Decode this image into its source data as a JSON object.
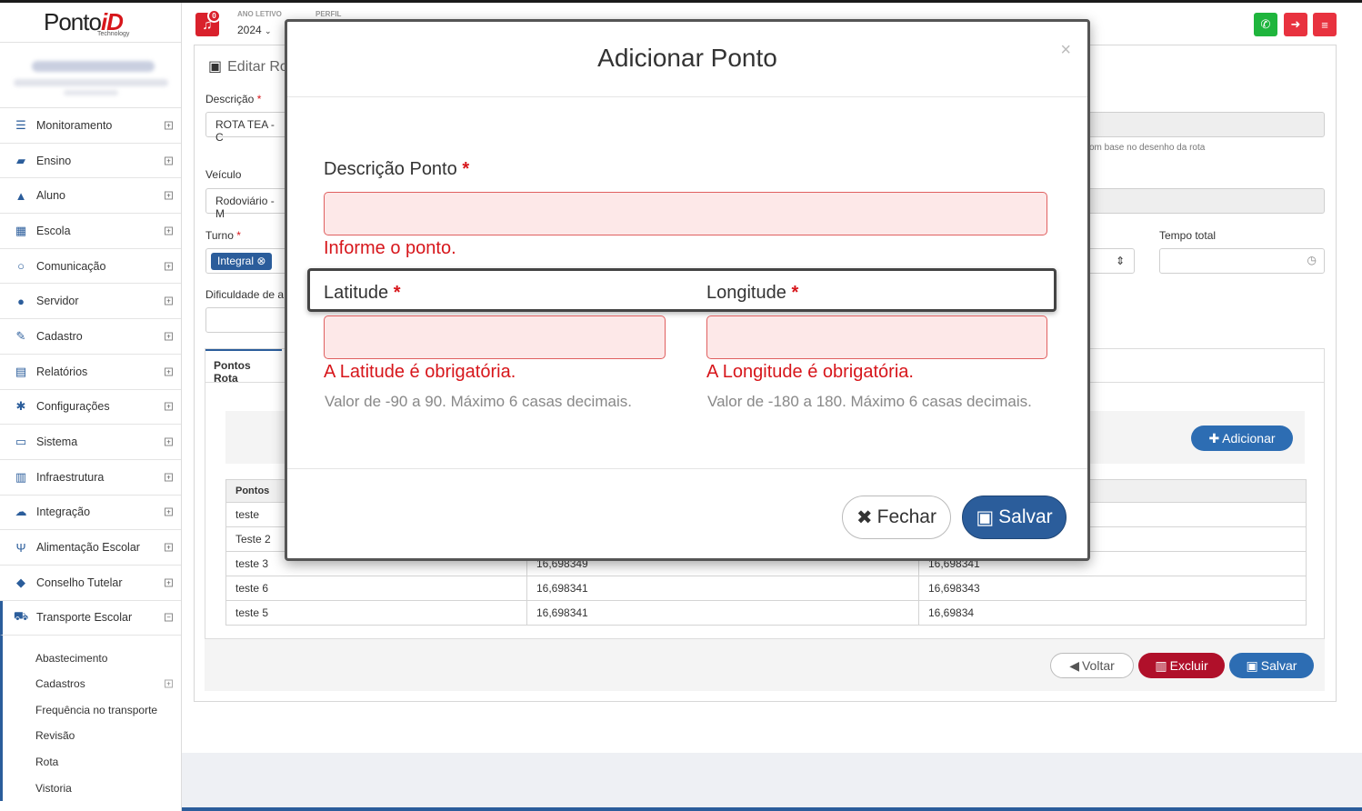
{
  "app": {
    "brand": "Ponto",
    "brand_id": "iD",
    "brand_sub": "Technology"
  },
  "header": {
    "notifications_count": "0",
    "ano_letivo_label": "ANO LETIVO",
    "ano_letivo_value": "2024",
    "perfil_label": "PERFIL",
    "btn_whatsapp_icon": "whatsapp-icon",
    "btn_logout_icon": "logout-icon",
    "btn_menu_icon": "menu-icon"
  },
  "sidebar": {
    "items": [
      {
        "label": "Monitoramento",
        "icon": "sliders-icon"
      },
      {
        "label": "Ensino",
        "icon": "book-icon"
      },
      {
        "label": "Aluno",
        "icon": "graduation-cap-icon"
      },
      {
        "label": "Escola",
        "icon": "building-icon"
      },
      {
        "label": "Comunicação",
        "icon": "chat-icon"
      },
      {
        "label": "Servidor",
        "icon": "user-icon"
      },
      {
        "label": "Cadastro",
        "icon": "edit-icon"
      },
      {
        "label": "Relatórios",
        "icon": "file-icon"
      },
      {
        "label": "Configurações",
        "icon": "gear-icon"
      },
      {
        "label": "Sistema",
        "icon": "monitor-icon"
      },
      {
        "label": "Infraestrutura",
        "icon": "server-icon"
      },
      {
        "label": "Integração",
        "icon": "cloud-icon"
      },
      {
        "label": "Alimentação Escolar",
        "icon": "utensils-icon"
      },
      {
        "label": "Conselho Tutelar",
        "icon": "shield-icon"
      },
      {
        "label": "Transporte Escolar",
        "icon": "car-icon"
      }
    ],
    "subitems": [
      "Abastecimento",
      "Cadastros",
      "Frequência no transporte",
      "Revisão",
      "Rota",
      "Vistoria"
    ]
  },
  "page": {
    "title": "Editar Ro",
    "descricao_label": "Descrição",
    "descricao_value": "ROTA TEA  - C",
    "veiculo_label": "Veículo",
    "veiculo_value": "Rodoviário - M",
    "turno_label": "Turno",
    "turno_tag": "Integral",
    "dificuldade_label": "Dificuldade de a",
    "tempo_total_label": "Tempo total",
    "hint": "om base no desenho da rota",
    "tab_label": "Pontos Rota",
    "add_button": "Adicionar",
    "table": {
      "header": [
        "Pontos",
        "",
        ""
      ],
      "rows": [
        [
          "teste",
          "",
          ""
        ],
        [
          "Teste 2",
          "",
          ""
        ],
        [
          "teste 3",
          "16,698349",
          "16,698341"
        ],
        [
          "teste 6",
          "16,698341",
          "16,698343"
        ],
        [
          "teste 5",
          "16,698341",
          "16,69834"
        ]
      ]
    },
    "btn_voltar": "Voltar",
    "btn_excluir": "Excluir",
    "btn_salvar": "Salvar"
  },
  "modal": {
    "title": "Adicionar Ponto",
    "close": "×",
    "descricao_label": "Descrição Ponto",
    "descricao_error": "Informe o ponto.",
    "latitude_label": "Latitude",
    "longitude_label": "Longitude",
    "latitude_error": "A Latitude é obrigatória.",
    "longitude_error": "A Longitude é obrigatória.",
    "latitude_help": "Valor de -90 a 90. Máximo 6 casas decimais.",
    "longitude_help": "Valor de -180 a 180. Máximo 6 casas decimais.",
    "btn_fechar": "Fechar",
    "btn_salvar": "Salvar",
    "required_mark": "*"
  },
  "colors": {
    "primary": "#2b5d9b",
    "danger": "#d7161b",
    "whatsapp": "#1fb53d",
    "excluir": "#b0102a",
    "error_bg": "#fde8e8"
  }
}
